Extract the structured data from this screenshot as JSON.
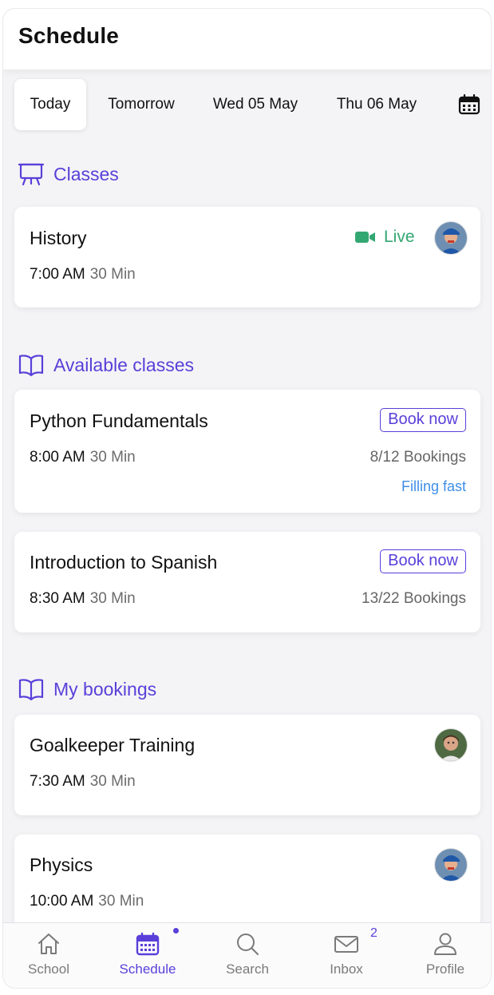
{
  "header": {
    "title": "Schedule"
  },
  "date_tabs": [
    {
      "label": "Today",
      "active": true
    },
    {
      "label": "Tomorrow",
      "active": false
    },
    {
      "label": "Wed 05 May",
      "active": false
    },
    {
      "label": "Thu 06 May",
      "active": false
    }
  ],
  "sections": {
    "classes": {
      "title": "Classes",
      "icon": "easel-icon"
    },
    "available": {
      "title": "Available classes",
      "icon": "book-icon"
    },
    "bookings": {
      "title": "My bookings",
      "icon": "book-icon"
    }
  },
  "classes": [
    {
      "title": "History",
      "time": "7:00 AM",
      "duration": "30 Min",
      "status": "Live"
    }
  ],
  "available_classes": [
    {
      "title": "Python Fundamentals",
      "time": "8:00 AM",
      "duration": "30 Min",
      "button": "Book now",
      "bookings": "8/12 Bookings",
      "note": "Filling fast"
    },
    {
      "title": "Introduction to Spanish",
      "time": "8:30 AM",
      "duration": "30 Min",
      "button": "Book now",
      "bookings": "13/22 Bookings"
    }
  ],
  "my_bookings": [
    {
      "title": "Goalkeeper Training",
      "time": "7:30 AM",
      "duration": "30 Min"
    },
    {
      "title": "Physics",
      "time": "10:00 AM",
      "duration": "30 Min"
    }
  ],
  "tabbar": [
    {
      "label": "School",
      "icon": "home-icon"
    },
    {
      "label": "Schedule",
      "icon": "calendar-icon",
      "active": true
    },
    {
      "label": "Search",
      "icon": "search-icon"
    },
    {
      "label": "Inbox",
      "icon": "mail-icon",
      "badge": "2"
    },
    {
      "label": "Profile",
      "icon": "user-icon"
    }
  ],
  "colors": {
    "accent": "#5a3fd9",
    "live": "#33a772",
    "filling": "#3f8ee8"
  }
}
